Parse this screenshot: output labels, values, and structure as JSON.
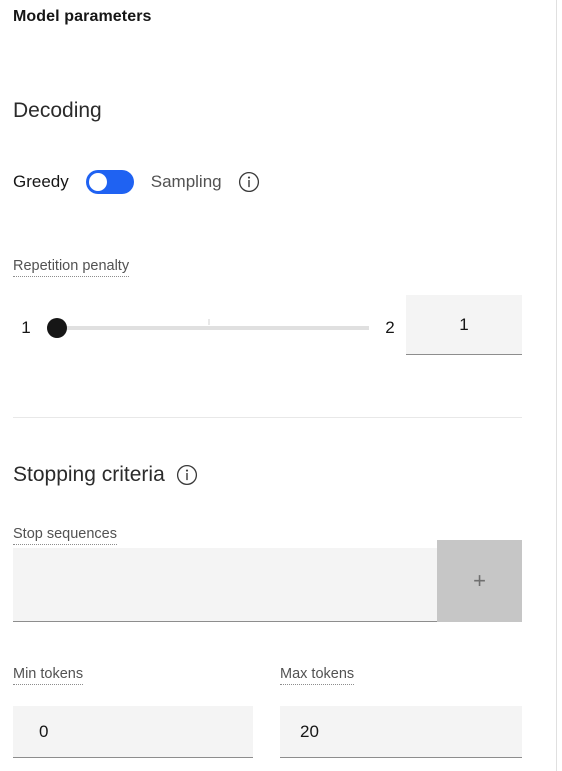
{
  "panel": {
    "title": "Model parameters"
  },
  "decoding": {
    "heading": "Decoding",
    "greedy_label": "Greedy",
    "sampling_label": "Sampling",
    "selected": "Greedy",
    "info_icon": "info-icon",
    "toggle_color": "#1f62f2"
  },
  "repetition_penalty": {
    "label": "Repetition penalty",
    "min": "1",
    "max": "2",
    "value": "1",
    "thumb_position_percent": 0
  },
  "stopping_criteria": {
    "heading": "Stopping criteria",
    "info_icon": "info-icon",
    "stop_sequences": {
      "label": "Stop sequences",
      "value": "",
      "placeholder": "",
      "add_button_label": "+",
      "add_button_icon": "plus-icon"
    },
    "min_tokens": {
      "label": "Min tokens",
      "value": "0"
    },
    "max_tokens": {
      "label": "Max tokens",
      "value": "20"
    }
  },
  "colors": {
    "accent": "#1f62f2",
    "field_bg": "#f4f4f4",
    "field_border": "#8d8d8d",
    "button_bg": "#c6c6c6",
    "divider": "#e8e8e8",
    "track": "#e0e0e0",
    "thumb": "#161616"
  }
}
